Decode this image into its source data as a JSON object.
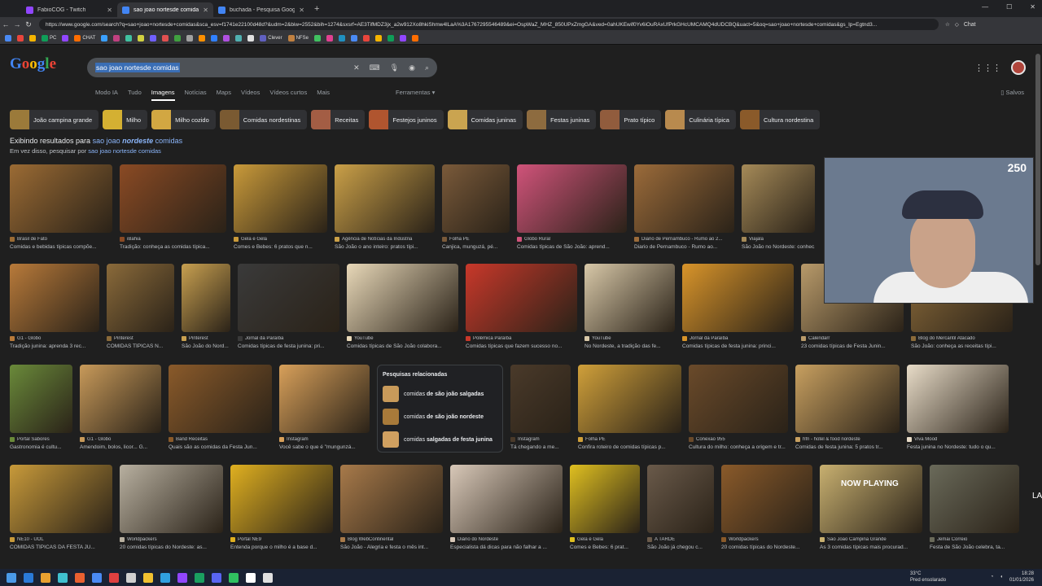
{
  "tabs": [
    {
      "title": "FabioCOG - Twitch",
      "color": "#9146ff",
      "active": false
    },
    {
      "title": "sao joao nortesde comidas - Pesquisa Google",
      "color": "#4285f4",
      "active": true
    },
    {
      "title": "buchada - Pesquisa Google",
      "color": "#4285f4",
      "active": false
    }
  ],
  "address": {
    "url": "https://www.google.com/search?q=sao+joao+nortesde+comidas&sca_esv=f1741e22100d48d?&udm=2&biw=2552&bih=1274&sxsrf=AE3TifMDZ3jx_a2w912Xo8hkiShmw4lLaA%3A1767295546489&ei=OspWaZ_MHZ_850UPxZmgGA&ved=0ahUKEwif0Yv6iOuRAxUfPrkGHcUMCAMQ4dUDCBQ&uact=5&oq=sao+joao+nortesde+comidas&gs_lp=Egtnd3...",
    "chat_label": "Chat"
  },
  "bookmarks": [
    "PC",
    "CHAT",
    "Clever",
    "NFSe"
  ],
  "search": {
    "query": "sao joao nortesde comidas"
  },
  "nav_tabs": [
    "Modo IA",
    "Tudo",
    "Imagens",
    "Notícias",
    "Maps",
    "Vídeos",
    "Vídeos curtos",
    "Mais"
  ],
  "tools_label": "Ferramentas",
  "saved_label": "Salvos",
  "chips": [
    {
      "label": "João campina grande",
      "color": "#9b7a3a"
    },
    {
      "label": "Milho",
      "color": "#d4b032"
    },
    {
      "label": "Milho cozido",
      "color": "#d2a742"
    },
    {
      "label": "Comidas nordestinas",
      "color": "#7a5a32"
    },
    {
      "label": "Receitas",
      "color": "#a35d44"
    },
    {
      "label": "Festejos juninos",
      "color": "#b0552f"
    },
    {
      "label": "Comidas juninas",
      "color": "#caa450"
    },
    {
      "label": "Festas juninas",
      "color": "#8d6b3f"
    },
    {
      "label": "Prato típico",
      "color": "#915c3d"
    },
    {
      "label": "Culinária típica",
      "color": "#b88a4e"
    },
    {
      "label": "Cultura nordestina",
      "color": "#8a5a2a"
    }
  ],
  "showing": {
    "prefix": "Exibindo resultados para ",
    "query_a": "sao joao ",
    "query_b": "nordeste",
    "query_c": " comidas",
    "instead_prefix": "Em vez disso, pesquisar por ",
    "instead_query": "sao joao nortesde comidas"
  },
  "rows": [
    [
      {
        "src": "Brasil de Fato",
        "cap": "Comidas e bebidas típicas compõe...",
        "w": 126,
        "c": "#9b6b34"
      },
      {
        "src": "iBahia",
        "cap": "Tradição: conheça as comidas típica...",
        "w": 131,
        "c": "#8a4a24"
      },
      {
        "src": "Gela e Gela",
        "cap": "Comes e Bebes: 6 pratos que n...",
        "w": 115,
        "c": "#c99a3a"
      },
      {
        "src": "Agência de Notícias da Indústria",
        "cap": "São João o ano inteiro: pratos típi...",
        "w": 123,
        "c": "#caa048"
      },
      {
        "src": "Folha PE",
        "cap": "Canjica, munguzá, pé...",
        "w": 83,
        "c": "#7a5a3a"
      },
      {
        "src": "Globo Rural",
        "cap": "Comidas típicas de São João: aprend...",
        "w": 135,
        "c": "#d0537a"
      },
      {
        "src": "Diario de Pernambuco - Rumo ao 2...",
        "cap": "Diario de Pernambuco - Rumo ao...",
        "w": 123,
        "c": "#9b6b3a"
      },
      {
        "src": "Viajala",
        "cap": "São João no Nordeste: conhec...",
        "w": 90,
        "c": "#a58a58"
      }
    ],
    [
      {
        "src": "G1 - Globo",
        "cap": "Tradição junina: aprenda 3 rec...",
        "w": 110,
        "c": "#b87a3a"
      },
      {
        "src": "Pinterest",
        "cap": "COMIDAS TÍPICAS N...",
        "w": 83,
        "c": "#8a6a3a"
      },
      {
        "src": "Pinterest",
        "cap": "São João do Nord...",
        "w": 60,
        "c": "#c8a050"
      },
      {
        "src": "Jornal da Paraíba",
        "cap": "Comidas típicas de festa junina: pri...",
        "w": 125,
        "c": "#3a3a3a"
      },
      {
        "src": "YouTube",
        "cap": "Comidas típicas de São João colabora...",
        "w": 137,
        "c": "#e8d8b8"
      },
      {
        "src": "Polêmica Paraíba",
        "cap": "Comidas típicas que fazem sucesso no...",
        "w": 137,
        "c": "#c8382a"
      },
      {
        "src": "YouTube",
        "cap": "No Nordeste, a tradição das fe...",
        "w": 111,
        "c": "#d8c8a8"
      },
      {
        "src": "Jornal da Paraíba",
        "cap": "Comidas típicas de festa junina: princi...",
        "w": 137,
        "c": "#d8942a"
      },
      {
        "src": "Calendarr",
        "cap": "23 comidas típicas de Festa Junin...",
        "w": 126,
        "c": "#b89a6a"
      },
      {
        "src": "Blog do Mercantil Atacado",
        "cap": "São João: conheça as receitas típi...",
        "w": 125,
        "c": "#8a6a3a"
      }
    ],
    [
      {
        "src": "Portal Sabores",
        "cap": "Gastronomia é cultu...",
        "w": 77,
        "c": "#6a8a3a"
      },
      {
        "src": "G1 - Globo",
        "cap": "Amendoim, bolos, licor... G...",
        "w": 100,
        "c": "#c89a5a"
      },
      {
        "src": "Band Receitas",
        "cap": "Quais são as comidas da Festa Jun...",
        "w": 127,
        "c": "#8a5a2a"
      },
      {
        "src": "Instagram",
        "cap": "Você sabe o que é \"mungunzá...",
        "w": 111,
        "c": "#d8a05a"
      },
      {
        "related": true,
        "w": 155
      },
      {
        "src": "Instagram",
        "cap": "Tá chegando a me...",
        "w": 74,
        "c": "#4a3a2a"
      },
      {
        "src": "Folha PE",
        "cap": "Confira roteiro de comidas típicas p...",
        "w": 127,
        "c": "#d0a03a"
      },
      {
        "src": "Conexão 955",
        "cap": "Cultura do milho: conheça a origem e tr...",
        "w": 122,
        "c": "#6a4a2a"
      },
      {
        "src": "hfn - hotel & food nordeste",
        "cap": "Comidas de festa junina: 5 pratos tr...",
        "w": 128,
        "c": "#c8a060"
      },
      {
        "src": "Viva Mood",
        "cap": "Festa junina no Nordeste: tudo o qu...",
        "w": 125,
        "c": "#e8dcc8"
      }
    ],
    [
      {
        "src": "NE10 - UOL",
        "cap": "COMIDAS TÍPICAS DA FESTA JU...",
        "w": 126,
        "c": "#c89a3a"
      },
      {
        "src": "Worldpackers",
        "cap": "20 comidas típicas do Nordeste: as...",
        "w": 127,
        "c": "#b8b0a0"
      },
      {
        "src": "Portal NE9",
        "cap": "Entenda porque o milho é a base d...",
        "w": 126,
        "c": "#e0b020"
      },
      {
        "src": "Blog WebContinental",
        "cap": "São João - Alegria e festa o mês int...",
        "w": 126,
        "c": "#a87a4a"
      },
      {
        "src": "Diário do Nordeste",
        "cap": "Especialista dá dicas para não falhar a ...",
        "w": 138,
        "c": "#d8c8b8"
      },
      {
        "src": "Gela e Gela",
        "cap": "Comes e Bebes: 6 prat...",
        "w": 86,
        "c": "#e0c020"
      },
      {
        "src": "A TARDE",
        "cap": "São João já chegou c...",
        "w": 82,
        "c": "#6a5a4a"
      },
      {
        "src": "Worldpackers",
        "cap": "20 comidas típicas do Nordeste...",
        "w": 112,
        "c": "#8a5a2a"
      },
      {
        "src": "São João Campina Grande",
        "cap": "As 3 comidas típicas mais procurad...",
        "w": 126,
        "c": "#c8b070"
      },
      {
        "src": "Jemai Correio",
        "cap": "Festa de São João celebra, ta...",
        "w": 110,
        "c": "#6a6a5a"
      }
    ]
  ],
  "related": {
    "title": "Pesquisas relacionadas",
    "items": [
      {
        "a": "comidas ",
        "b": "de são joão salgadas"
      },
      {
        "a": "comidas ",
        "b": "de são joão nordeste"
      },
      {
        "a": "comidas ",
        "b": "salgadas de festa junina"
      }
    ]
  },
  "overlay": {
    "badge": "250",
    "now_playing": "NOW PLAYING",
    "side": "LA"
  },
  "taskbar": {
    "temp": "33°C",
    "weather": "Pred ensolarado",
    "time": "18:28",
    "date": "01/01/2026"
  }
}
